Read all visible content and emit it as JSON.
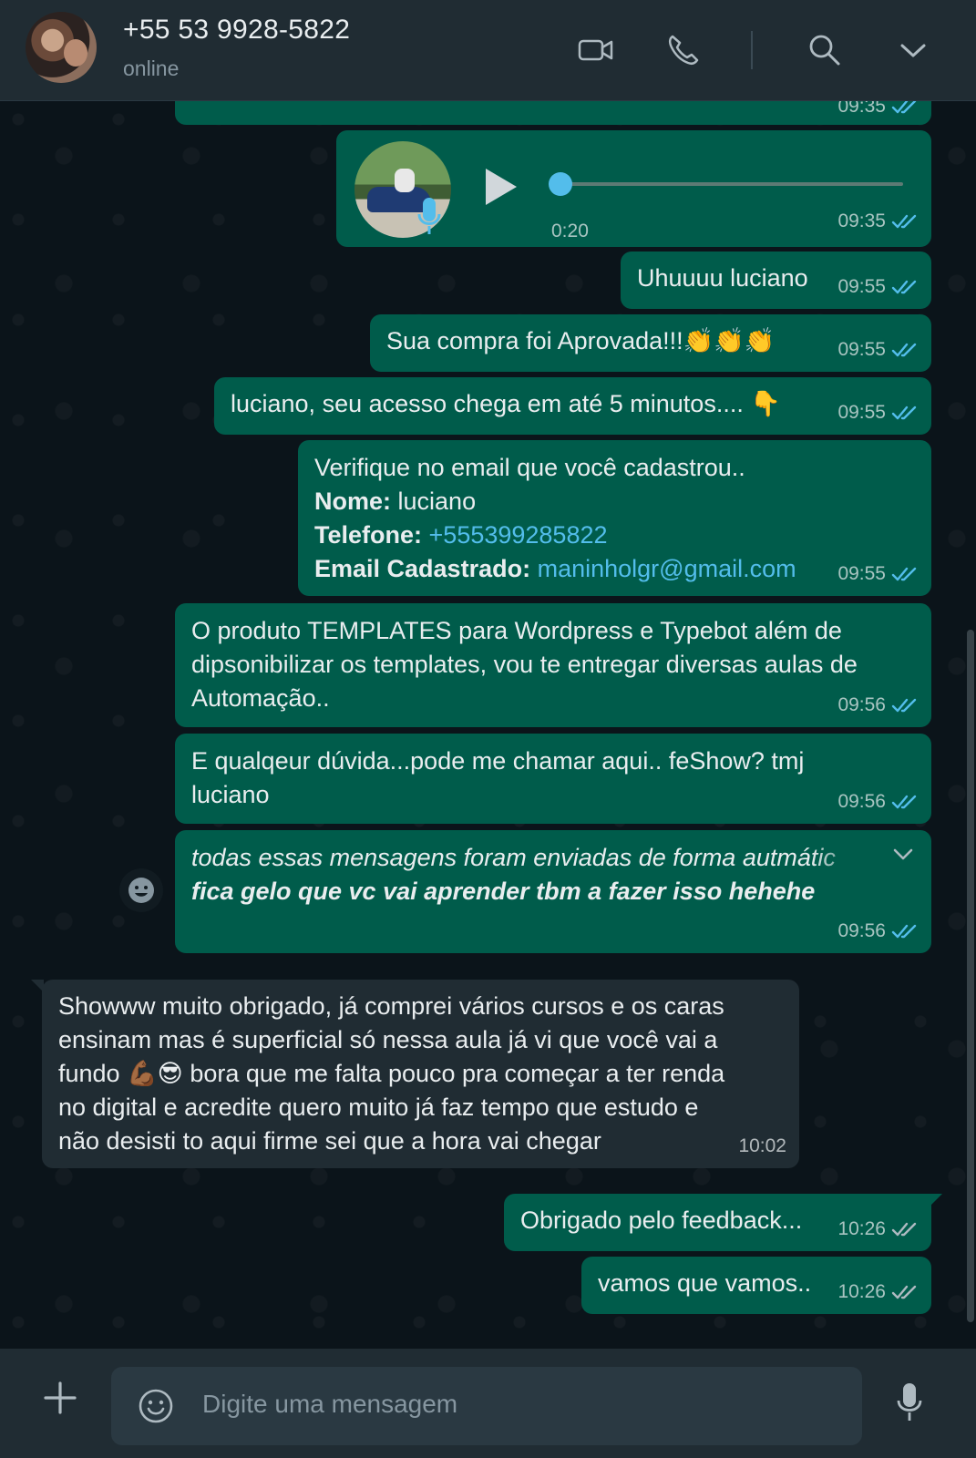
{
  "header": {
    "contact_name": "+55 53 9928-5822",
    "status": "online",
    "icons": [
      "video-call-icon",
      "voice-call-icon",
      "search-icon",
      "chevron-down-icon"
    ]
  },
  "messages": [
    {
      "id": "m0",
      "direction": "out",
      "time": "09:35",
      "ticks": "read",
      "partial": true
    },
    {
      "id": "m1",
      "direction": "out",
      "type": "audio",
      "duration": "0:20",
      "time": "09:35",
      "ticks": "read"
    },
    {
      "id": "m2",
      "direction": "out",
      "text": "Uhuuuu luciano",
      "time": "09:55",
      "ticks": "read"
    },
    {
      "id": "m3",
      "direction": "out",
      "text": "Sua compra foi Aprovada!!!👏👏👏",
      "time": "09:55",
      "ticks": "read"
    },
    {
      "id": "m4",
      "direction": "out",
      "text": "luciano, seu acesso chega em até 5 minutos.... 👇",
      "time": "09:55",
      "ticks": "read"
    },
    {
      "id": "m5",
      "direction": "out",
      "line1": "Verifique no email que você cadastrou..",
      "name_label": "Nome:",
      "name_value": "luciano",
      "phone_label": "Telefone:",
      "phone_value": "+555399285822",
      "email_label": "Email Cadastrado:",
      "email_value": "maninholgr@gmail.com",
      "time": "09:55",
      "ticks": "read"
    },
    {
      "id": "m6",
      "direction": "out",
      "lines": [
        "O produto TEMPLATES para Wordpress e Typebot além de",
        "dipsonibilizar os templates, vou te entregar diversas aulas de",
        "Automação.."
      ],
      "time": "09:56",
      "ticks": "read"
    },
    {
      "id": "m7",
      "direction": "out",
      "lines": [
        "E qualqeur dúvida...pode me chamar aqui.. feShow? tmj",
        "luciano"
      ],
      "time": "09:56",
      "ticks": "read"
    },
    {
      "id": "m8",
      "direction": "out",
      "line1": "todas essas mensagens foram enviadas de forma autmátic",
      "line2": "fica gelo que vc vai aprender tbm a fazer isso hehehe",
      "time": "09:56",
      "ticks": "read"
    },
    {
      "id": "m9",
      "direction": "in",
      "lines": [
        "Showww muito obrigado, já comprei vários cursos e os caras",
        "ensinam mas é superficial só nessa aula já vi que você vai a",
        "fundo 💪🏾😎 bora que me falta pouco pra começar a ter renda",
        "no digital e acredite quero muito já faz tempo que estudo e",
        "não desisti to aqui firme sei que a hora vai chegar"
      ],
      "time": "10:02"
    },
    {
      "id": "m10",
      "direction": "out",
      "text": "Obrigado pelo feedback...",
      "time": "10:26",
      "ticks": "delivered"
    },
    {
      "id": "m11",
      "direction": "out",
      "text": "vamos que vamos..",
      "time": "10:26",
      "ticks": "delivered"
    }
  ],
  "composer": {
    "placeholder": "Digite uma mensagem",
    "icons": [
      "plus-icon",
      "emoji-icon",
      "microphone-icon"
    ]
  },
  "colors": {
    "outgoing_bubble": "#005c4b",
    "incoming_bubble": "#202c33",
    "background": "#0b141a",
    "read_ticks": "#53bdeb",
    "link": "#53bdeb"
  }
}
